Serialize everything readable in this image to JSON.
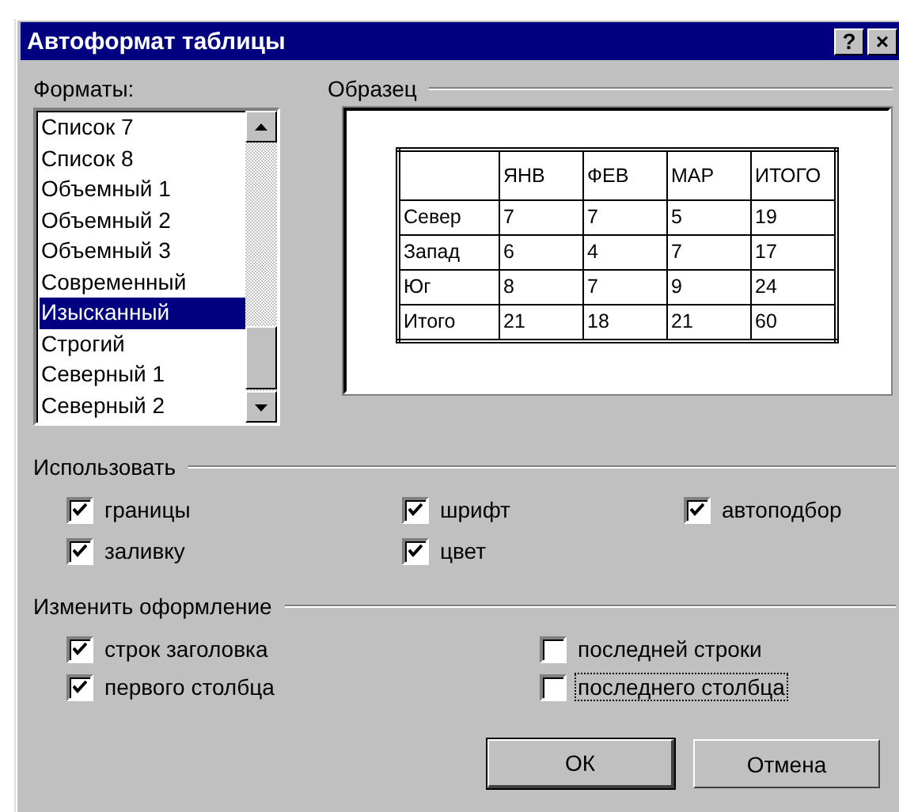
{
  "window": {
    "title": "Автоформат таблицы",
    "buttons": [
      "?",
      "×"
    ]
  },
  "formats": {
    "label": "Форматы:",
    "items": [
      {
        "label": "Список 7",
        "selected": false
      },
      {
        "label": "Список 8",
        "selected": false
      },
      {
        "label": "Объемный 1",
        "selected": false
      },
      {
        "label": "Объемный 2",
        "selected": false
      },
      {
        "label": "Объемный 3",
        "selected": false
      },
      {
        "label": "Современный",
        "selected": false
      },
      {
        "label": "Изысканный",
        "selected": true
      },
      {
        "label": "Строгий",
        "selected": false
      },
      {
        "label": "Северный 1",
        "selected": false
      },
      {
        "label": "Северный 2",
        "selected": false
      }
    ]
  },
  "sample": {
    "label": "Образец",
    "columns": [
      "ЯНВ",
      "ФЕВ",
      "МАР",
      "ИТОГО"
    ],
    "rows": [
      {
        "label": "Север",
        "cells": [
          "7",
          "7",
          "5",
          "19"
        ]
      },
      {
        "label": "Запад",
        "cells": [
          "6",
          "4",
          "7",
          "17"
        ]
      },
      {
        "label": "Юг",
        "cells": [
          "8",
          "7",
          "9",
          "24"
        ]
      },
      {
        "label": "Итого",
        "cells": [
          "21",
          "18",
          "21",
          "60"
        ]
      }
    ]
  },
  "use": {
    "label": "Использовать",
    "options": [
      {
        "label": "границы",
        "checked": true
      },
      {
        "label": "шрифт",
        "checked": true
      },
      {
        "label": "автоподбор",
        "checked": true
      },
      {
        "label": "заливку",
        "checked": true
      },
      {
        "label": "цвет",
        "checked": true
      }
    ]
  },
  "change": {
    "label": "Изменить оформление",
    "options": [
      {
        "label": "строк заголовка",
        "checked": true,
        "focused": false
      },
      {
        "label": "последней строки",
        "checked": false,
        "focused": false
      },
      {
        "label": "первого столбца",
        "checked": true,
        "focused": false
      },
      {
        "label": "последнего столбца",
        "checked": false,
        "focused": true
      }
    ]
  },
  "buttons": [
    "ОК",
    "Отмена"
  ]
}
